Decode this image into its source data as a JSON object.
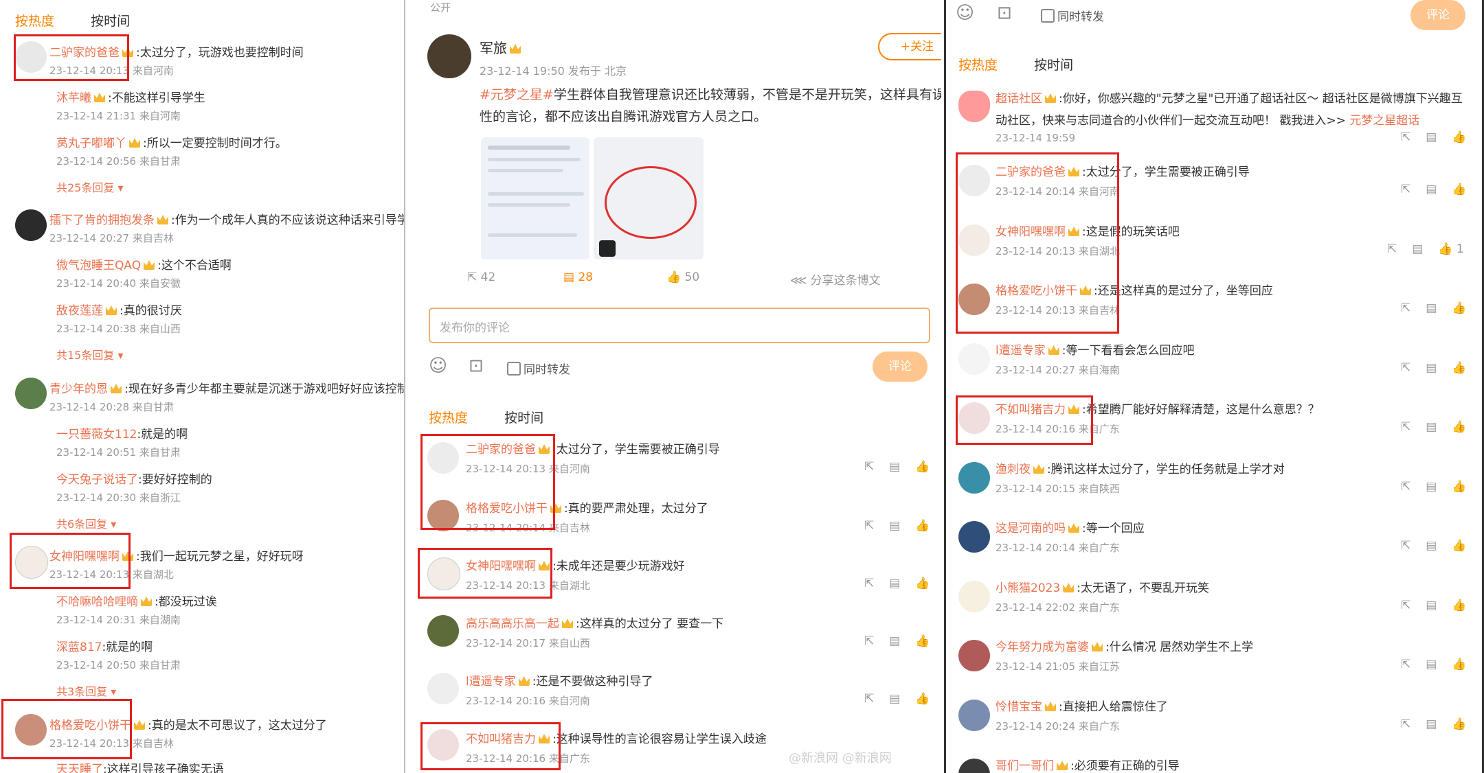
{
  "panel1": {
    "tabs": {
      "hot": "按热度",
      "time": "按时间"
    },
    "threads": [
      {
        "name": "二驴家的爸爸",
        "text": ":太过分了，玩游戏也要控制时间",
        "time": "23-12-14 20:13 来自河南",
        "replies": [
          {
            "name": "沐芊曦",
            "text": ":不能这样引导学生",
            "time": "23-12-14 21:31 来自河南"
          },
          {
            "name": "莴丸子嘟嘟丫",
            "text": ":所以一定要控制时间才行。",
            "time": "23-12-14 20:56 来自甘肃"
          }
        ],
        "more": "共25条回复"
      },
      {
        "name": "擂下了肯的拥抱发条",
        "text": ":作为一个成年人真的不应该说这种话来引导学生",
        "time": "23-12-14 20:27 来自吉林",
        "replies": [
          {
            "name": "微气泡睡王QAQ",
            "text": ":这个不合适啊",
            "time": "23-12-14 20:40 来自安徽"
          },
          {
            "name": "敌夜莲莲",
            "text": ":真的很讨厌",
            "time": "23-12-14 20:38 来自山西"
          }
        ],
        "more": "共15条回复"
      },
      {
        "name": "青少年的恩",
        "text": ":现在好多青少年都主要就是沉迷于游戏吧好好应该控制一下",
        "time": "23-12-14 20:28 来自甘肃",
        "replies": [
          {
            "name": "一只蔷薇女112",
            "text": ":就是的啊",
            "time": "23-12-14 20:51 来自甘肃"
          },
          {
            "name": "今天兔子说话了",
            "text": ":要好好控制的",
            "time": "23-12-14 20:30 来自浙江"
          }
        ],
        "more": "共6条回复"
      },
      {
        "name": "女神阳嘿嘿啊",
        "text": ":我们一起玩元梦之星，好好玩呀",
        "time": "23-12-14 20:13 来自湖北",
        "replies": [
          {
            "name": "不哈嘛哈哈哩嘀",
            "text": ":都没玩过诶",
            "time": "23-12-14 20:31 来自湖南"
          },
          {
            "name": "深蓝817",
            "text": ":就是的啊",
            "time": "23-12-14 20:50 来自甘肃"
          }
        ],
        "more": "共3条回复"
      },
      {
        "name": "格格爱吃小饼干",
        "text": ":真的是太不可思议了，这太过分了",
        "time": "23-12-14 20:13 来自吉林",
        "replies": [
          {
            "name": "天天睡了",
            "text": ":这样引导孩子确实无语",
            "time": ""
          }
        ],
        "more": ""
      }
    ]
  },
  "panel2": {
    "public_label": "公开",
    "author": "军旅",
    "follow": "+关注",
    "post_time": "23-12-14 19:50 发布于 北京",
    "topic": "#元梦之星#",
    "post_body": "学生群体自我管理意识还比较薄弱，不管是不是开玩笑，这样具有误导性的言论，都不应该出自腾讯游戏官方人员之口。",
    "stats": {
      "repost": "42",
      "comment": "28",
      "like": "50",
      "share": "分享这条博文"
    },
    "comment_placeholder": "发布你的评论",
    "forward_label": "同时转发",
    "submit": "评论",
    "tabs": {
      "hot": "按热度",
      "time": "按时间"
    },
    "comments": [
      {
        "name": "二驴家的爸爸",
        "text": ":太过分了，学生需要被正确引导",
        "time": "23-12-14 20:13 来自河南"
      },
      {
        "name": "格格爱吃小饼干",
        "text": ":真的要严肃处理，太过分了",
        "time": "23-12-14 20:14 来自吉林"
      },
      {
        "name": "女神阳嘿嘿啊",
        "text": ":未成年还是要少玩游戏好",
        "time": "23-12-14 20:13 来自湖北"
      },
      {
        "name": "高乐高高乐高一起",
        "text": ":这样真的太过分了 要查一下",
        "time": "23-12-14 20:17 来自山西"
      },
      {
        "name": "l遭遥专家",
        "text": ":还是不要做这种引导了",
        "time": "23-12-14 20:16 来自河南"
      },
      {
        "name": "不如叫猪吉力",
        "text": ":这种误导性的言论很容易让学生误入歧途",
        "time": "23-12-14 20:16 来自广东"
      }
    ],
    "watermark": "@新浪网 @新浪网"
  },
  "panel3": {
    "forward_label": "同时转发",
    "submit": "评论",
    "tabs": {
      "hot": "按热度",
      "time": "按时间"
    },
    "super_topic": {
      "name": "超话社区",
      "text": ":你好，你感兴趣的\"元梦之星\"已开通了超话社区～ 超话社区是微博旗下兴趣互动社区，快来与志同道合的小伙伴们一起交流互动吧！ 戳我进入>>",
      "link": "元梦之星超话",
      "time": "23-12-14 19:59"
    },
    "comments": [
      {
        "name": "二驴家的爸爸",
        "text": ":太过分了，学生需要被正确引导",
        "time": "23-12-14 20:14 来自河南",
        "like": ""
      },
      {
        "name": "女神阳嘿嘿啊",
        "text": ":这是假的玩笑话吧",
        "time": "23-12-14 20:13 来自湖北",
        "like": "1"
      },
      {
        "name": "格格爱吃小饼干",
        "text": ":还是这样真的是过分了，坐等回应",
        "time": "23-12-14 20:13 来自吉林",
        "like": ""
      },
      {
        "name": "l遭遥专家",
        "text": ":等一下看看会怎么回应吧",
        "time": "23-12-14 20:27 来自海南",
        "like": ""
      },
      {
        "name": "不如叫猪吉力",
        "text": ":希望腾厂能好好解释清楚，这是什么意思？？",
        "time": "23-12-14 20:16 来自广东",
        "like": ""
      },
      {
        "name": "渔刺夜",
        "text": ":腾讯这样太过分了，学生的任务就是上学才对",
        "time": "23-12-14 20:15 来自陕西",
        "like": ""
      },
      {
        "name": "这是河南的吗",
        "text": ":等一个回应",
        "time": "23-12-14 20:14 来自广东",
        "like": ""
      },
      {
        "name": "小熊猫2023",
        "text": ":太无语了，不要乱开玩笑",
        "time": "23-12-14 22:02 来自广东",
        "like": ""
      },
      {
        "name": "今年努力成为富婆",
        "text": ":什么情况 居然劝学生不上学",
        "time": "23-12-14 21:05 来自江苏",
        "like": ""
      },
      {
        "name": "怜惜宝宝",
        "text": ":直接把人给震惊住了",
        "time": "23-12-14 20:24 来自广东",
        "like": ""
      },
      {
        "name": "哥们一哥们",
        "text": ":必须要有正确的引导",
        "time": "",
        "like": ""
      }
    ]
  }
}
